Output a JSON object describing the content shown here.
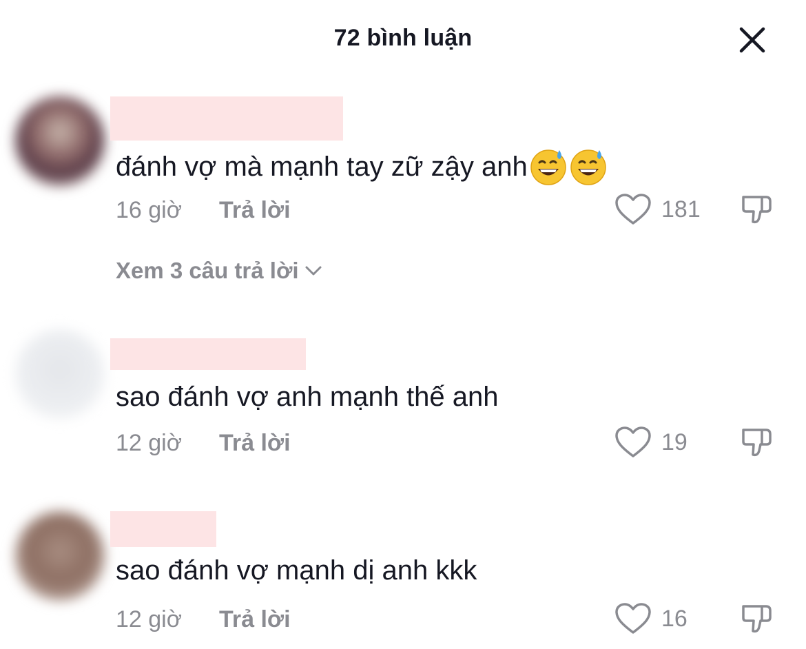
{
  "header": {
    "title": "72 bình luận",
    "close_icon": "close-icon"
  },
  "comments": [
    {
      "text": "đánh vợ mà mạnh tay zữ zậy anh",
      "emoji": [
        "grinning-sweat-emoji",
        "grinning-sweat-emoji"
      ],
      "time": "16 giờ",
      "reply_label": "Trả lời",
      "likes": "181"
    },
    {
      "text": "sao đánh vợ anh mạnh thế anh",
      "time": "12 giờ",
      "reply_label": "Trả lời",
      "likes": "19"
    },
    {
      "text": "sao đánh vợ mạnh dị anh kkk",
      "time": "12 giờ",
      "reply_label": "Trả lời",
      "likes": "16"
    }
  ],
  "view_replies": {
    "label": "Xem 3 câu trả lời"
  },
  "colors": {
    "primary_text": "#161823",
    "secondary_text": "#8a8b91",
    "redaction": "#fde4e5"
  }
}
